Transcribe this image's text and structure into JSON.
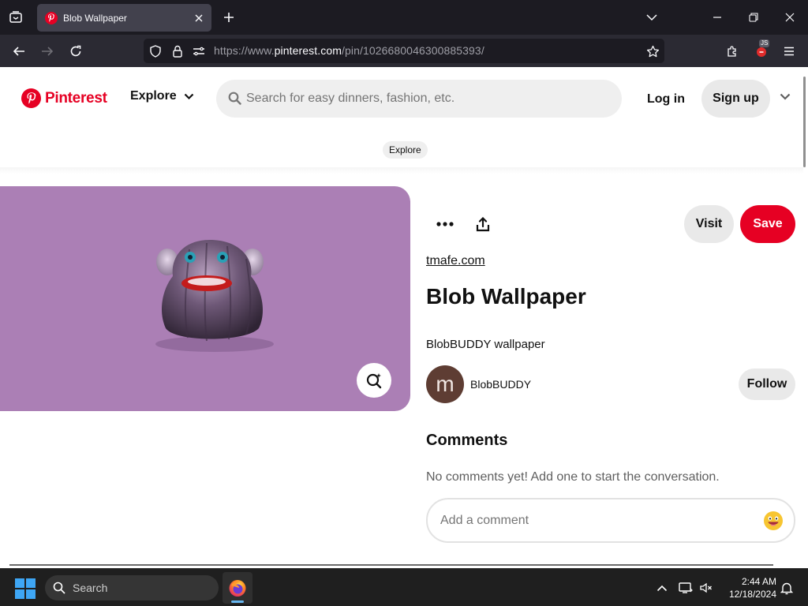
{
  "browser": {
    "tab_title": "Blob Wallpaper",
    "url_prefix": "https://www.",
    "url_host": "pinterest.com",
    "url_path": "/pin/1026680046300885393/",
    "extension_badge": "JS"
  },
  "header": {
    "brand": "Pinterest",
    "explore_label": "Explore",
    "search_placeholder": "Search for easy dinners, fashion, etc.",
    "login_label": "Log in",
    "signup_label": "Sign up",
    "breadcrumb": "Explore"
  },
  "pin": {
    "source": "tmafe.com",
    "title": "Blob Wallpaper",
    "description": "BlobBUDDY wallpaper",
    "visit_label": "Visit",
    "save_label": "Save",
    "creator": {
      "avatar_letter": "m",
      "name": "BlobBUDDY",
      "follow_label": "Follow"
    },
    "image_background": "#ab7fb5"
  },
  "comments": {
    "heading": "Comments",
    "empty_text": "No comments yet! Add one to start the conversation.",
    "placeholder": "Add a comment"
  },
  "taskbar": {
    "search_label": "Search",
    "time": "2:44 AM",
    "date": "12/18/2024"
  },
  "colors": {
    "brand_red": "#e60023",
    "button_gray": "#e9e9e9"
  },
  "icons": {
    "tab_list": "tab-list-icon",
    "back": "back-arrow-icon",
    "forward": "forward-arrow-icon",
    "reload": "reload-icon",
    "shield": "shield-icon",
    "lock": "lock-icon",
    "permissions": "permissions-icon",
    "bookmark": "star-icon",
    "extensions": "puzzle-icon",
    "menu": "hamburger-menu-icon",
    "search": "search-icon",
    "more": "ellipsis-icon",
    "share": "share-icon",
    "visual_search": "lens-icon",
    "emoji": "emoji-icon"
  }
}
